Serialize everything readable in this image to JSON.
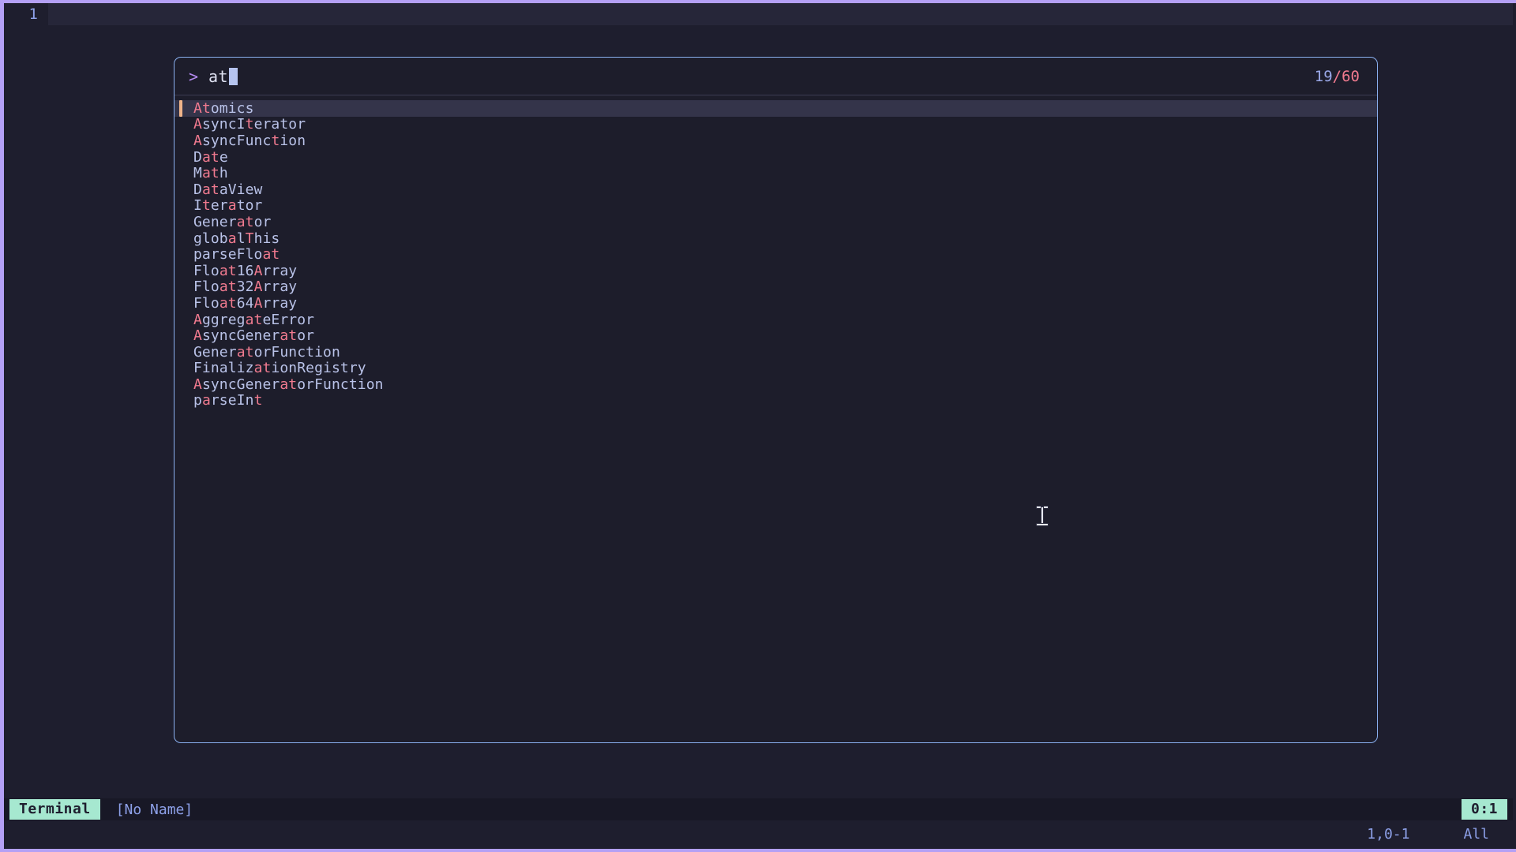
{
  "editor": {
    "line_number": "1"
  },
  "finder": {
    "prompt_symbol": ">",
    "query": "at",
    "query_placeholder": "",
    "counter_current": "19",
    "counter_total": "/60",
    "selected_index": 0,
    "results": [
      {
        "segments": [
          {
            "t": "A",
            "h": true
          },
          {
            "t": "t",
            "h": true
          },
          {
            "t": "omics",
            "h": false
          }
        ]
      },
      {
        "segments": [
          {
            "t": "A",
            "h": true
          },
          {
            "t": "syncI",
            "h": false
          },
          {
            "t": "t",
            "h": true
          },
          {
            "t": "erator",
            "h": false
          }
        ]
      },
      {
        "segments": [
          {
            "t": "A",
            "h": true
          },
          {
            "t": "syncFunc",
            "h": false
          },
          {
            "t": "t",
            "h": true
          },
          {
            "t": "ion",
            "h": false
          }
        ]
      },
      {
        "segments": [
          {
            "t": "D",
            "h": false
          },
          {
            "t": "at",
            "h": true
          },
          {
            "t": "e",
            "h": false
          }
        ]
      },
      {
        "segments": [
          {
            "t": "M",
            "h": false
          },
          {
            "t": "at",
            "h": true
          },
          {
            "t": "h",
            "h": false
          }
        ]
      },
      {
        "segments": [
          {
            "t": "D",
            "h": false
          },
          {
            "t": "at",
            "h": true
          },
          {
            "t": "aView",
            "h": false
          }
        ]
      },
      {
        "segments": [
          {
            "t": "I",
            "h": false
          },
          {
            "t": "t",
            "h": true
          },
          {
            "t": "er",
            "h": false
          },
          {
            "t": "a",
            "h": true
          },
          {
            "t": "tor",
            "h": false
          }
        ]
      },
      {
        "segments": [
          {
            "t": "Gener",
            "h": false
          },
          {
            "t": "at",
            "h": true
          },
          {
            "t": "or",
            "h": false
          }
        ]
      },
      {
        "segments": [
          {
            "t": "glob",
            "h": false
          },
          {
            "t": "a",
            "h": true
          },
          {
            "t": "l",
            "h": false
          },
          {
            "t": "T",
            "h": true
          },
          {
            "t": "his",
            "h": false
          }
        ]
      },
      {
        "segments": [
          {
            "t": "parseFlo",
            "h": false
          },
          {
            "t": "at",
            "h": true
          }
        ]
      },
      {
        "segments": [
          {
            "t": "Flo",
            "h": false
          },
          {
            "t": "at",
            "h": true
          },
          {
            "t": "16",
            "h": false
          },
          {
            "t": "A",
            "h": true
          },
          {
            "t": "rray",
            "h": false
          }
        ]
      },
      {
        "segments": [
          {
            "t": "Flo",
            "h": false
          },
          {
            "t": "at",
            "h": true
          },
          {
            "t": "32",
            "h": false
          },
          {
            "t": "A",
            "h": true
          },
          {
            "t": "rray",
            "h": false
          }
        ]
      },
      {
        "segments": [
          {
            "t": "Flo",
            "h": false
          },
          {
            "t": "at",
            "h": true
          },
          {
            "t": "64",
            "h": false
          },
          {
            "t": "A",
            "h": true
          },
          {
            "t": "rray",
            "h": false
          }
        ]
      },
      {
        "segments": [
          {
            "t": "A",
            "h": true
          },
          {
            "t": "ggreg",
            "h": false
          },
          {
            "t": "at",
            "h": true
          },
          {
            "t": "eError",
            "h": false
          }
        ]
      },
      {
        "segments": [
          {
            "t": "A",
            "h": true
          },
          {
            "t": "syncGener",
            "h": false
          },
          {
            "t": "at",
            "h": true
          },
          {
            "t": "or",
            "h": false
          }
        ]
      },
      {
        "segments": [
          {
            "t": "Gener",
            "h": false
          },
          {
            "t": "at",
            "h": true
          },
          {
            "t": "orFunction",
            "h": false
          }
        ]
      },
      {
        "segments": [
          {
            "t": "Finaliz",
            "h": false
          },
          {
            "t": "at",
            "h": true
          },
          {
            "t": "ionRegistry",
            "h": false
          }
        ]
      },
      {
        "segments": [
          {
            "t": "A",
            "h": true
          },
          {
            "t": "syncGener",
            "h": false
          },
          {
            "t": "at",
            "h": true
          },
          {
            "t": "orFunction",
            "h": false
          }
        ]
      },
      {
        "segments": [
          {
            "t": "p",
            "h": false
          },
          {
            "t": "a",
            "h": true
          },
          {
            "t": "rseIn",
            "h": false
          },
          {
            "t": "t",
            "h": true
          }
        ]
      }
    ]
  },
  "statusline": {
    "mode": "Terminal",
    "file_name": "[No Name]",
    "position_badge": "0:1",
    "ruler": "1,0-1",
    "scroll_position": "All"
  },
  "colors": {
    "background": "#1e1e2e",
    "window_border": "#b4a0f5",
    "popup_border": "#8ab0f0",
    "match_highlight": "#f07a8f",
    "text": "#b9c2e8",
    "accent_mint": "#a6e8d0",
    "select_bar": "#f0b48a"
  }
}
